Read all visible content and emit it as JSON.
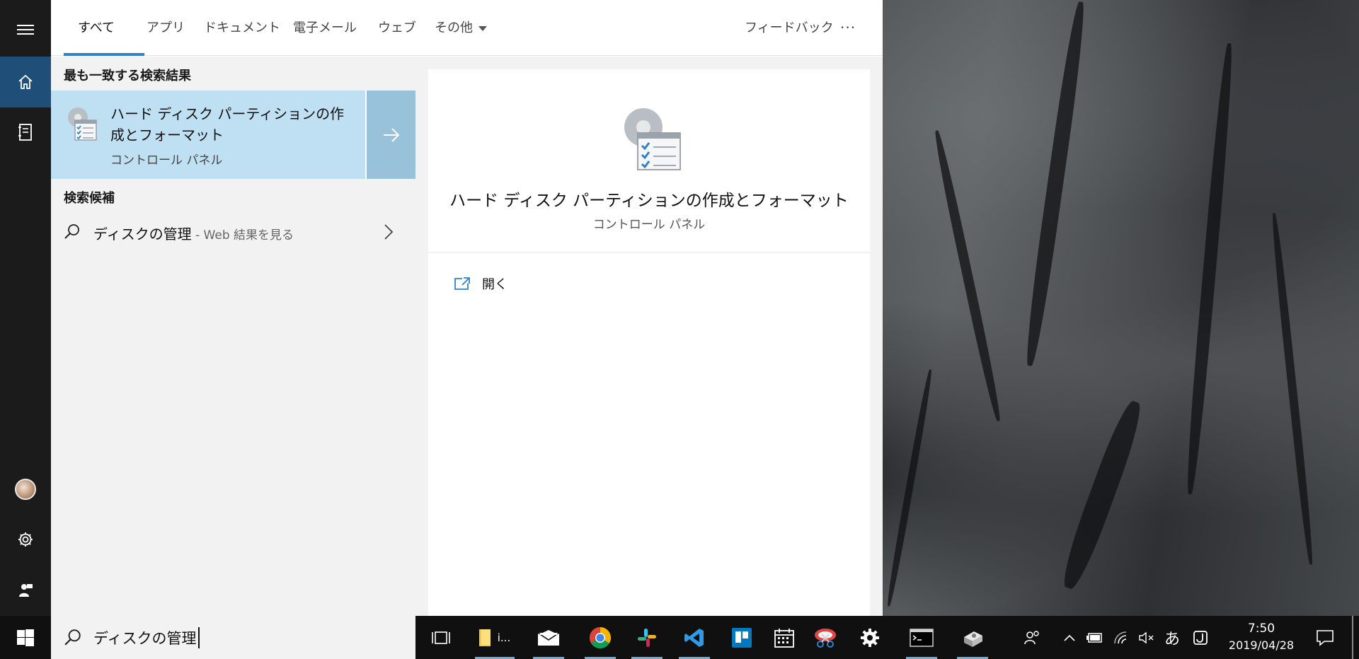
{
  "search_panel": {
    "tabs": [
      {
        "label": "すべて",
        "active": true
      },
      {
        "label": "アプリ"
      },
      {
        "label": "ドキュメント"
      },
      {
        "label": "電子メール"
      },
      {
        "label": "ウェブ"
      },
      {
        "label": "その他"
      }
    ],
    "feedback_label": "フィードバック",
    "more_label": "···",
    "best_match": {
      "section_label": "最も一致する検索結果",
      "title": "ハード ディスク パーティションの作成とフォーマット",
      "subtitle": "コントロール パネル",
      "icon": "disk-management-icon"
    },
    "suggestions": {
      "section_label": "検索候補",
      "items": [
        {
          "query": "ディスクの管理",
          "suffix": " - Web 結果を見る"
        }
      ]
    },
    "preview": {
      "title": "ハード ディスク パーティションの作成とフォーマット",
      "subtitle": "コントロール パネル",
      "actions": [
        {
          "label": "開く",
          "icon": "open-icon"
        }
      ]
    },
    "search_box": {
      "value": "ディスクの管理"
    },
    "rail_icons": [
      "hamburger-icon",
      "home-icon",
      "notebook-icon",
      "avatar",
      "gear-icon",
      "feedback-person-icon"
    ]
  },
  "taskbar": {
    "apps": [
      {
        "name": "task-view-icon"
      },
      {
        "name": "file-explorer-icon",
        "label": "i..."
      },
      {
        "name": "mail-icon"
      },
      {
        "name": "chrome-icon"
      },
      {
        "name": "slack-icon"
      },
      {
        "name": "vscode-icon"
      },
      {
        "name": "trello-icon"
      },
      {
        "name": "calendar-icon"
      },
      {
        "name": "snipping-tool-icon"
      },
      {
        "name": "settings-icon"
      },
      {
        "name": "command-prompt-icon"
      },
      {
        "name": "disk-app-icon"
      }
    ],
    "tray": {
      "ime_label": "あ",
      "time": "7:50",
      "date": "2019/04/28"
    }
  },
  "colors": {
    "accent": "#2f82c8",
    "rail_bg": "#1b1b1b",
    "rail_active": "#1f4e79",
    "best_match_bg": "#bfe0f2",
    "taskbar_bg": "#101010"
  }
}
